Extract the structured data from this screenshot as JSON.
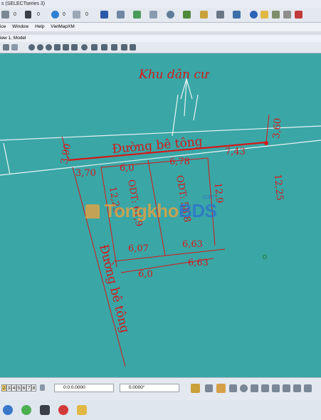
{
  "window": {
    "title": "s (SELECTseries 3)"
  },
  "menu": {
    "items": [
      "ice",
      "Window",
      "Help",
      "VietMapXM"
    ]
  },
  "view": {
    "tab_label": "iew 1, Model"
  },
  "toolbar": {
    "level_value_1": "0",
    "level_value_2": "0",
    "level_value_3": "0",
    "level_value_4": "0"
  },
  "drawing": {
    "labels": {
      "khu_dan_cu": "Khu dân cư",
      "duong_be_tong_top": "Đường bê tông",
      "duong_be_tong_left": "Đường bê tông",
      "odt_left": "ODT: 61,9",
      "odt_right": "ODT: 58,8"
    },
    "dimensions": {
      "d_3_60": "3,60",
      "d_3_90": "3,90",
      "d_3_70": "3,70",
      "d_6_0_top": "6,0",
      "d_6_78": "6,78",
      "d_7_43": "7,43",
      "d_12_25_left": "12,25",
      "d_12_9": "12,9",
      "d_12_25_right": "12,25",
      "d_6_07": "6,07",
      "d_6_63_a": "6,63",
      "d_6_0_bottom": "6,0",
      "d_6_63_b": "6,63"
    },
    "colors": {
      "background": "#3aa6a6",
      "line": "#d21a1a",
      "text": "#d21a1a"
    }
  },
  "watermark": {
    "part1": "Tongkho",
    "part2": "BDS",
    "dot_com": ".com",
    "color1": "#f0a23a",
    "color2": "#2a6fd0"
  },
  "statusbar": {
    "view_tabs": [
      "2",
      "3",
      "4",
      "5",
      "6",
      "7",
      "8"
    ],
    "x_field": "0:0:0.0000",
    "angle_field": "0.0000°"
  }
}
